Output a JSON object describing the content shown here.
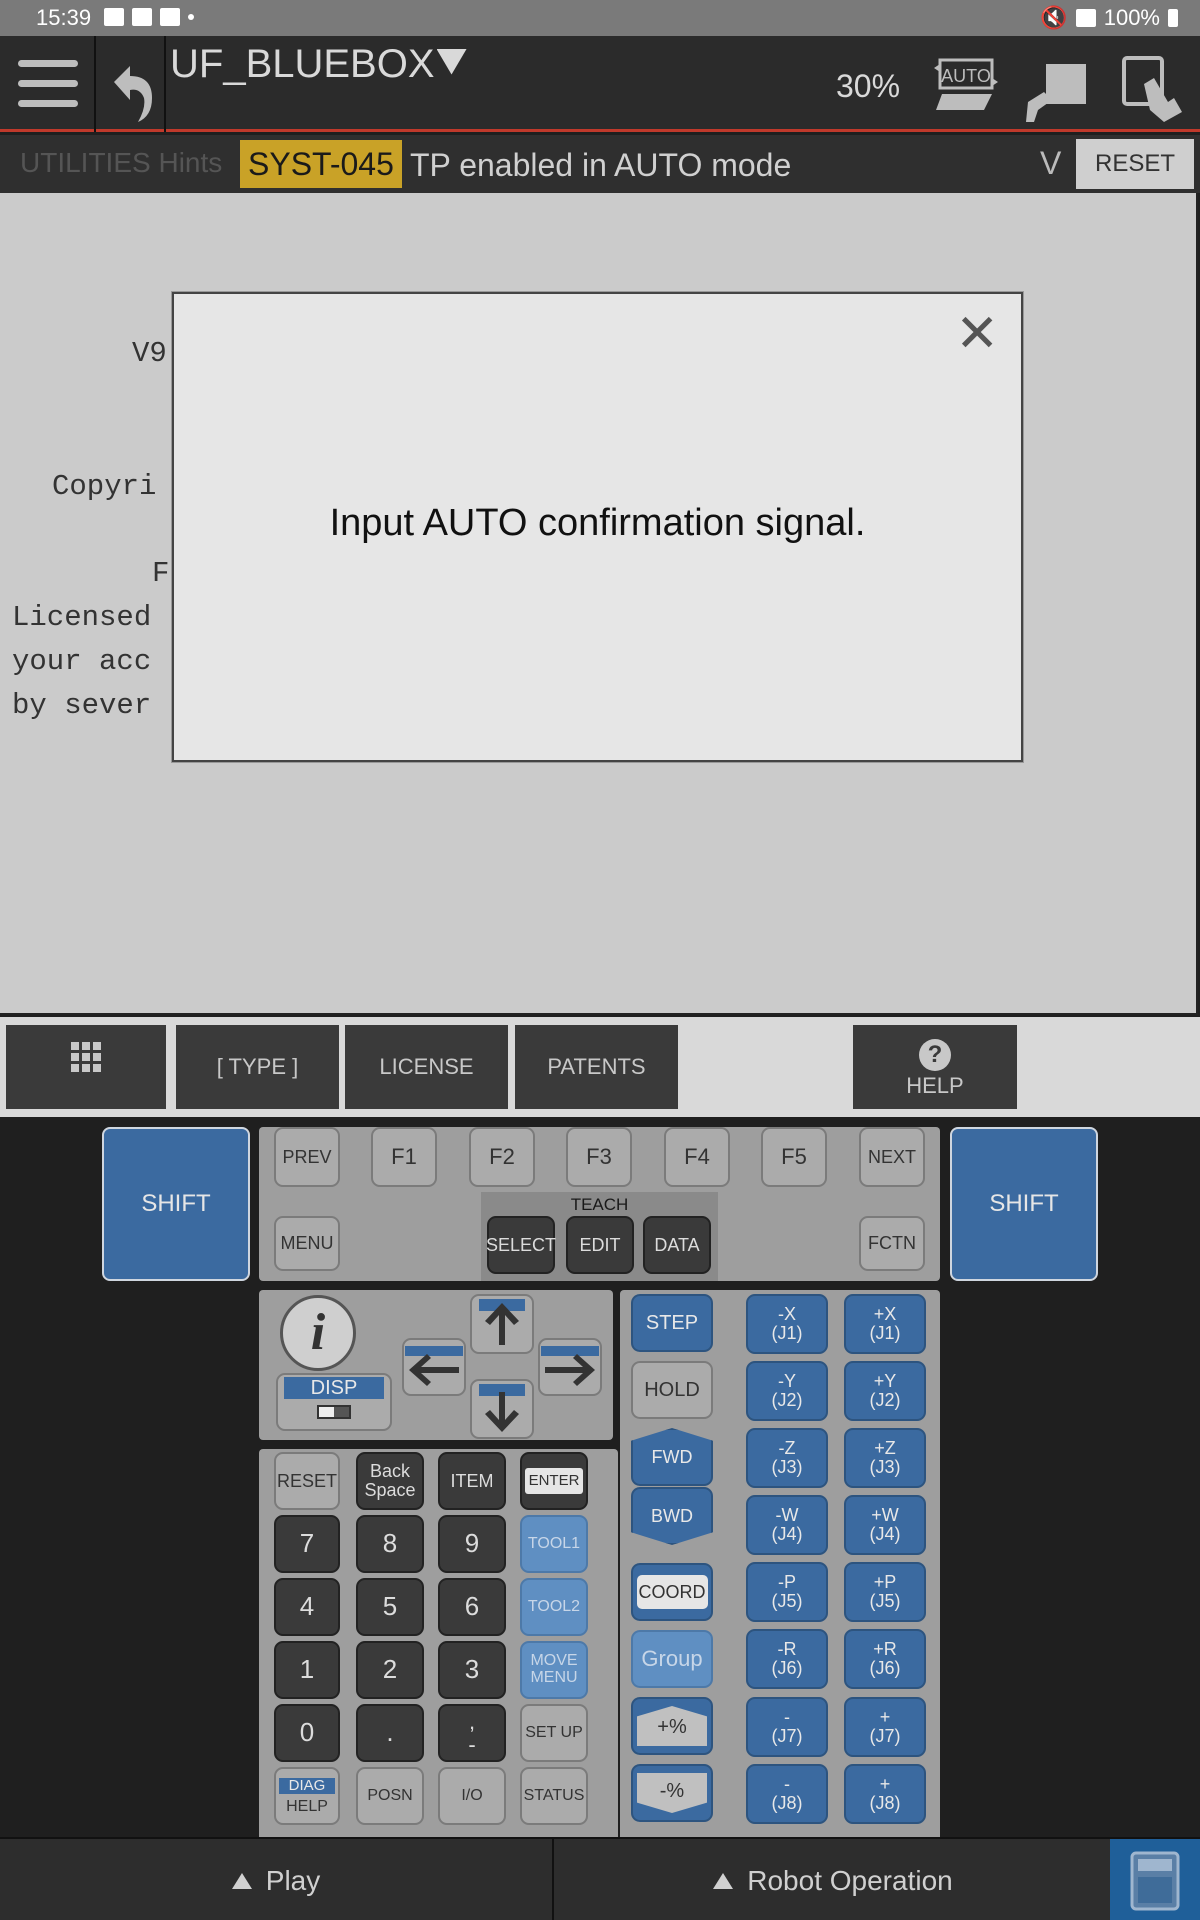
{
  "status_bar": {
    "time": "15:39",
    "battery": "100%"
  },
  "title_bar": {
    "title": "UF_BLUEBOX",
    "speed": "30%",
    "auto_label": "AUTO"
  },
  "alarm_bar": {
    "hints": "UTILITIES Hints",
    "code": "SYST-045",
    "message": "TP enabled in AUTO mode",
    "expand": "V",
    "reset": "RESET"
  },
  "content_lines": [
    {
      "text": "V9"
    },
    {
      "text": "Copyri"
    },
    {
      "text": "F"
    },
    {
      "text": "Licensed"
    },
    {
      "text": "your acc"
    },
    {
      "text": "by sever"
    }
  ],
  "modal": {
    "message": "Input AUTO confirmation signal.",
    "close": "✕"
  },
  "function_keys": {
    "type": "[ TYPE ]",
    "license": "LICENSE",
    "patents": "PATENTS",
    "help": "HELP"
  },
  "keypad": {
    "shift": "SHIFT",
    "prev": "PREV",
    "next": "NEXT",
    "menu": "MENU",
    "fctn": "FCTN",
    "f_keys": [
      "F1",
      "F2",
      "F3",
      "F4",
      "F5"
    ],
    "teach": "TEACH",
    "select": "SELECT",
    "edit": "EDIT",
    "data": "DATA",
    "disp": "DISP",
    "reset": "RESET",
    "backspace_1": "Back",
    "backspace_2": "Space",
    "item": "ITEM",
    "enter": "ENTER",
    "num": [
      "7",
      "8",
      "9",
      "4",
      "5",
      "6",
      "1",
      "2",
      "3",
      "0",
      "."
    ],
    "comma": ",",
    "dash": "-",
    "tool1": "TOOL1",
    "tool2": "TOOL2",
    "move_1": "MOVE",
    "move_2": "MENU",
    "setup": "SET UP",
    "diag": "DIAG",
    "help": "HELP",
    "posn": "POSN",
    "io": "I/O",
    "status": "STATUS",
    "step": "STEP",
    "hold": "HOLD",
    "fwd": "FWD",
    "bwd": "BWD",
    "coord": "COORD",
    "group": "Group",
    "plus_pct": "+%",
    "minus_pct": "-%",
    "jog_minus": [
      {
        "a": "-X",
        "b": "(J1)"
      },
      {
        "a": "-Y",
        "b": "(J2)"
      },
      {
        "a": "-Z",
        "b": "(J3)"
      },
      {
        "a": "-W",
        "b": "(J4)"
      },
      {
        "a": "-P",
        "b": "(J5)"
      },
      {
        "a": "-R",
        "b": "(J6)"
      },
      {
        "a": "-",
        "b": "(J7)"
      },
      {
        "a": "-",
        "b": "(J8)"
      }
    ],
    "jog_plus": [
      {
        "a": "+X",
        "b": "(J1)"
      },
      {
        "a": "+Y",
        "b": "(J2)"
      },
      {
        "a": "+Z",
        "b": "(J3)"
      },
      {
        "a": "+W",
        "b": "(J4)"
      },
      {
        "a": "+P",
        "b": "(J5)"
      },
      {
        "a": "+R",
        "b": "(J6)"
      },
      {
        "a": "+",
        "b": "(J7)"
      },
      {
        "a": "+",
        "b": "(J8)"
      }
    ]
  },
  "bottom_bar": {
    "play": "Play",
    "robot_operation": "Robot Operation"
  },
  "colors": {
    "accent_blue": "#3b6aa0",
    "alarm_yellow": "#c9a227",
    "alarm_line": "#c0392b"
  }
}
